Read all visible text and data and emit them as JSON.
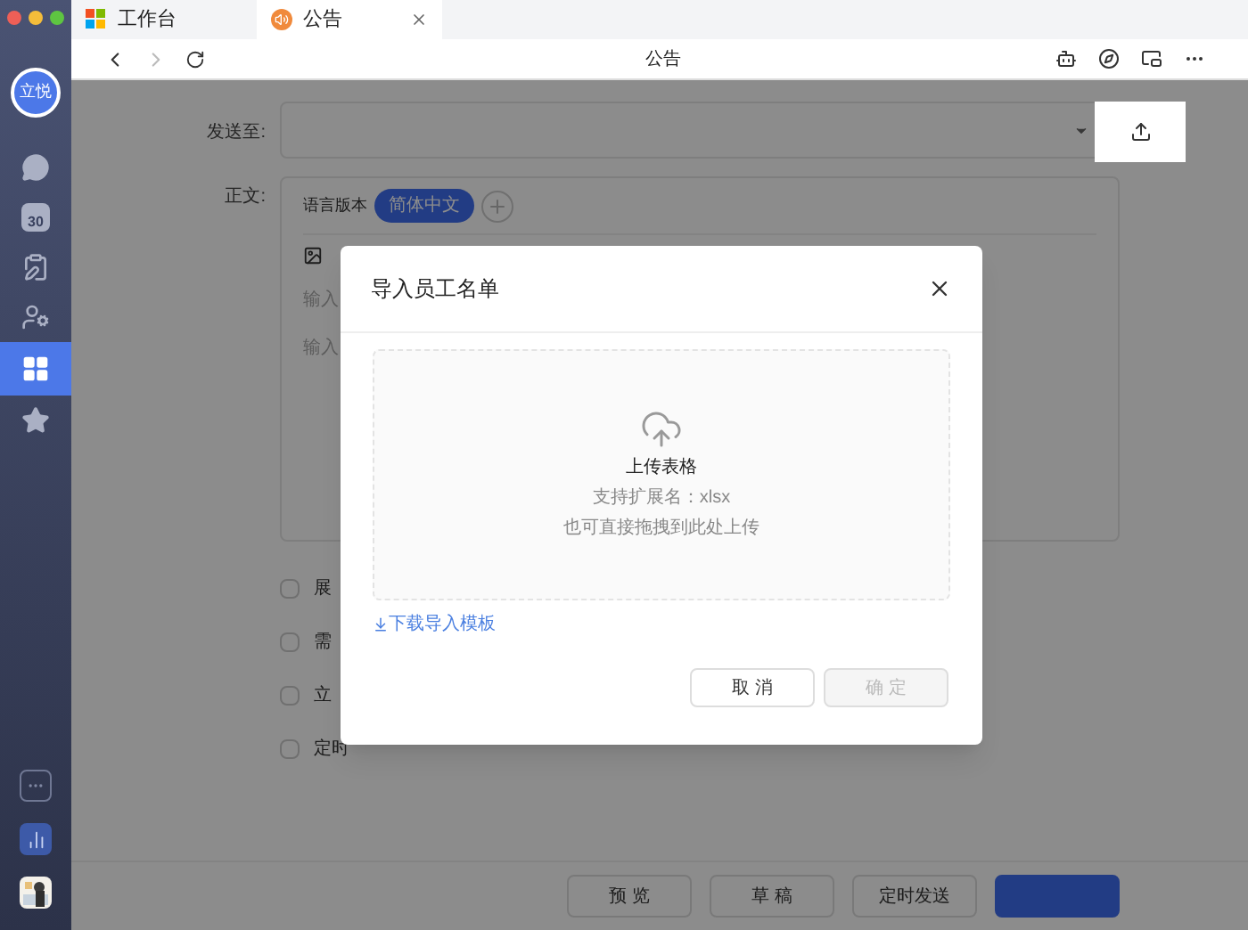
{
  "tabs": [
    {
      "kind": "workbench",
      "label": "工作台",
      "selected": false,
      "closable": false
    },
    {
      "kind": "notice",
      "label": "公告",
      "selected": true,
      "closable": true
    }
  ],
  "toolbar": {
    "title": "公告"
  },
  "sidebar": {
    "avatar": "立悦",
    "items": [
      {
        "kind": "chat",
        "selected": false
      },
      {
        "kind": "calendar",
        "text": "30",
        "selected": false
      },
      {
        "kind": "form",
        "selected": false
      },
      {
        "kind": "contacts",
        "selected": false
      },
      {
        "kind": "apps",
        "selected": true
      },
      {
        "kind": "favorites",
        "selected": false
      }
    ]
  },
  "form": {
    "send_to_label": "发送至:",
    "body_label": "正文:",
    "language_label": "语言版本",
    "language_chip": "简体中文",
    "placeholders": [
      "输入",
      "输入"
    ],
    "options": [
      {
        "label": "展",
        "checked": false
      },
      {
        "label": "需",
        "checked": false
      },
      {
        "label": "立",
        "checked": false
      },
      {
        "label": "定时",
        "checked": false
      }
    ]
  },
  "footer_buttons": [
    {
      "label": "预 览",
      "kind": "default"
    },
    {
      "label": "草 稿",
      "kind": "default"
    },
    {
      "label": "定时发送",
      "kind": "default"
    },
    {
      "kind": "primary"
    }
  ],
  "dialog": {
    "title": "导入员工名单",
    "upload_title": "上传表格",
    "upload_hint": "支持扩展名：xlsx",
    "upload_drag": "也可直接拖拽到此处上传",
    "template_link": "下载导入模板",
    "buttons": [
      {
        "label": "取 消",
        "disabled": false
      },
      {
        "label": "确 定",
        "disabled": true
      }
    ]
  }
}
